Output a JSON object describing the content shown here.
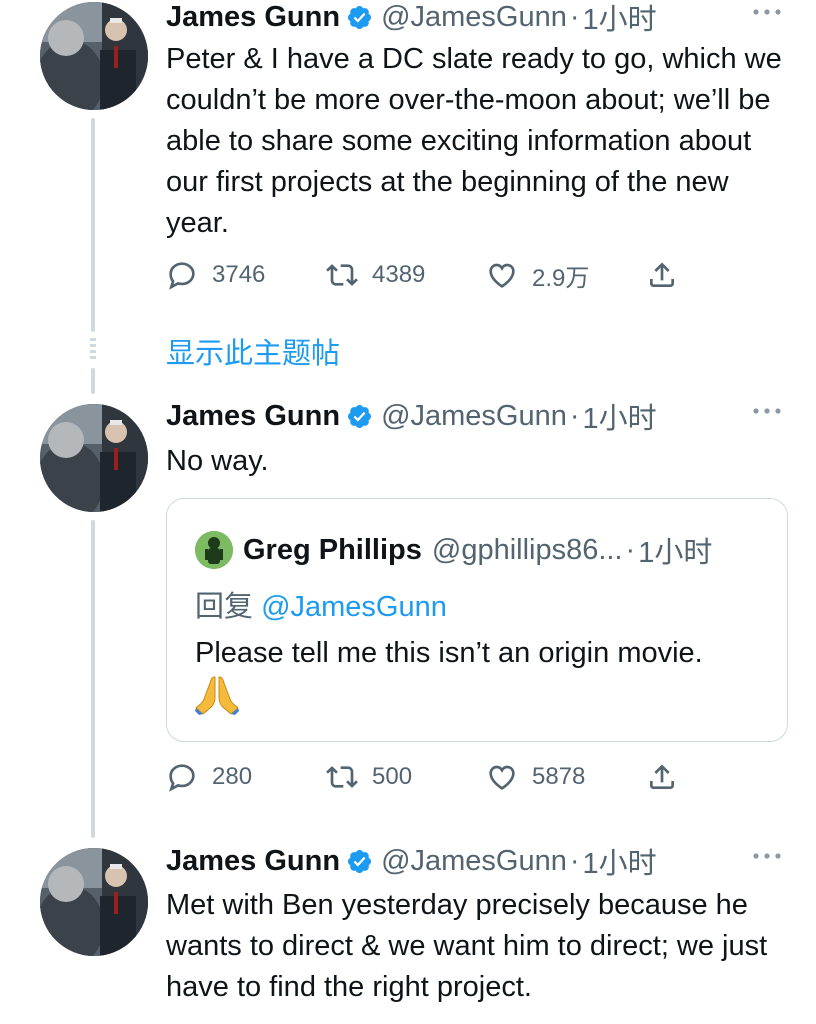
{
  "tweets": [
    {
      "name": "James Gunn",
      "handle": "@JamesGunn",
      "sep": "·",
      "time": "1小时",
      "text": "Peter & I have a DC slate ready to go, which we couldn’t be more over-the-moon about; we’ll be able to share some exciting information about our first projects at the beginning of the new year.",
      "replies": "3746",
      "retweets": "4389",
      "likes": "2.9万"
    },
    {
      "name": "James Gunn",
      "handle": "@JamesGunn",
      "sep": "·",
      "time": "1小时",
      "text": "No way.",
      "replies": "280",
      "retweets": "500",
      "likes": "5878"
    },
    {
      "name": "James Gunn",
      "handle": "@JamesGunn",
      "sep": "·",
      "time": "1小时",
      "text": "Met with Ben yesterday precisely because he wants to direct & we want him to direct; we just have to find the right project."
    }
  ],
  "show_thread": "显示此主题帖",
  "quote": {
    "name": "Greg Phillips",
    "handle": "@gphillips86...",
    "sep": "·",
    "time": "1小时",
    "reply_prefix": "回复",
    "reply_to": "@JamesGunn",
    "text": "Please tell me this isn’t an origin movie.",
    "emoji": "folded-hands-emoji"
  },
  "icons": {
    "reply": "reply-icon",
    "retweet": "retweet-icon",
    "like": "heart-icon",
    "share": "share-icon",
    "more": "more-icon",
    "verified": "verified-badge-icon"
  },
  "colors": {
    "accent": "#1d9bf0",
    "secondary_text": "#536471",
    "thread_line": "#cfd9de"
  }
}
